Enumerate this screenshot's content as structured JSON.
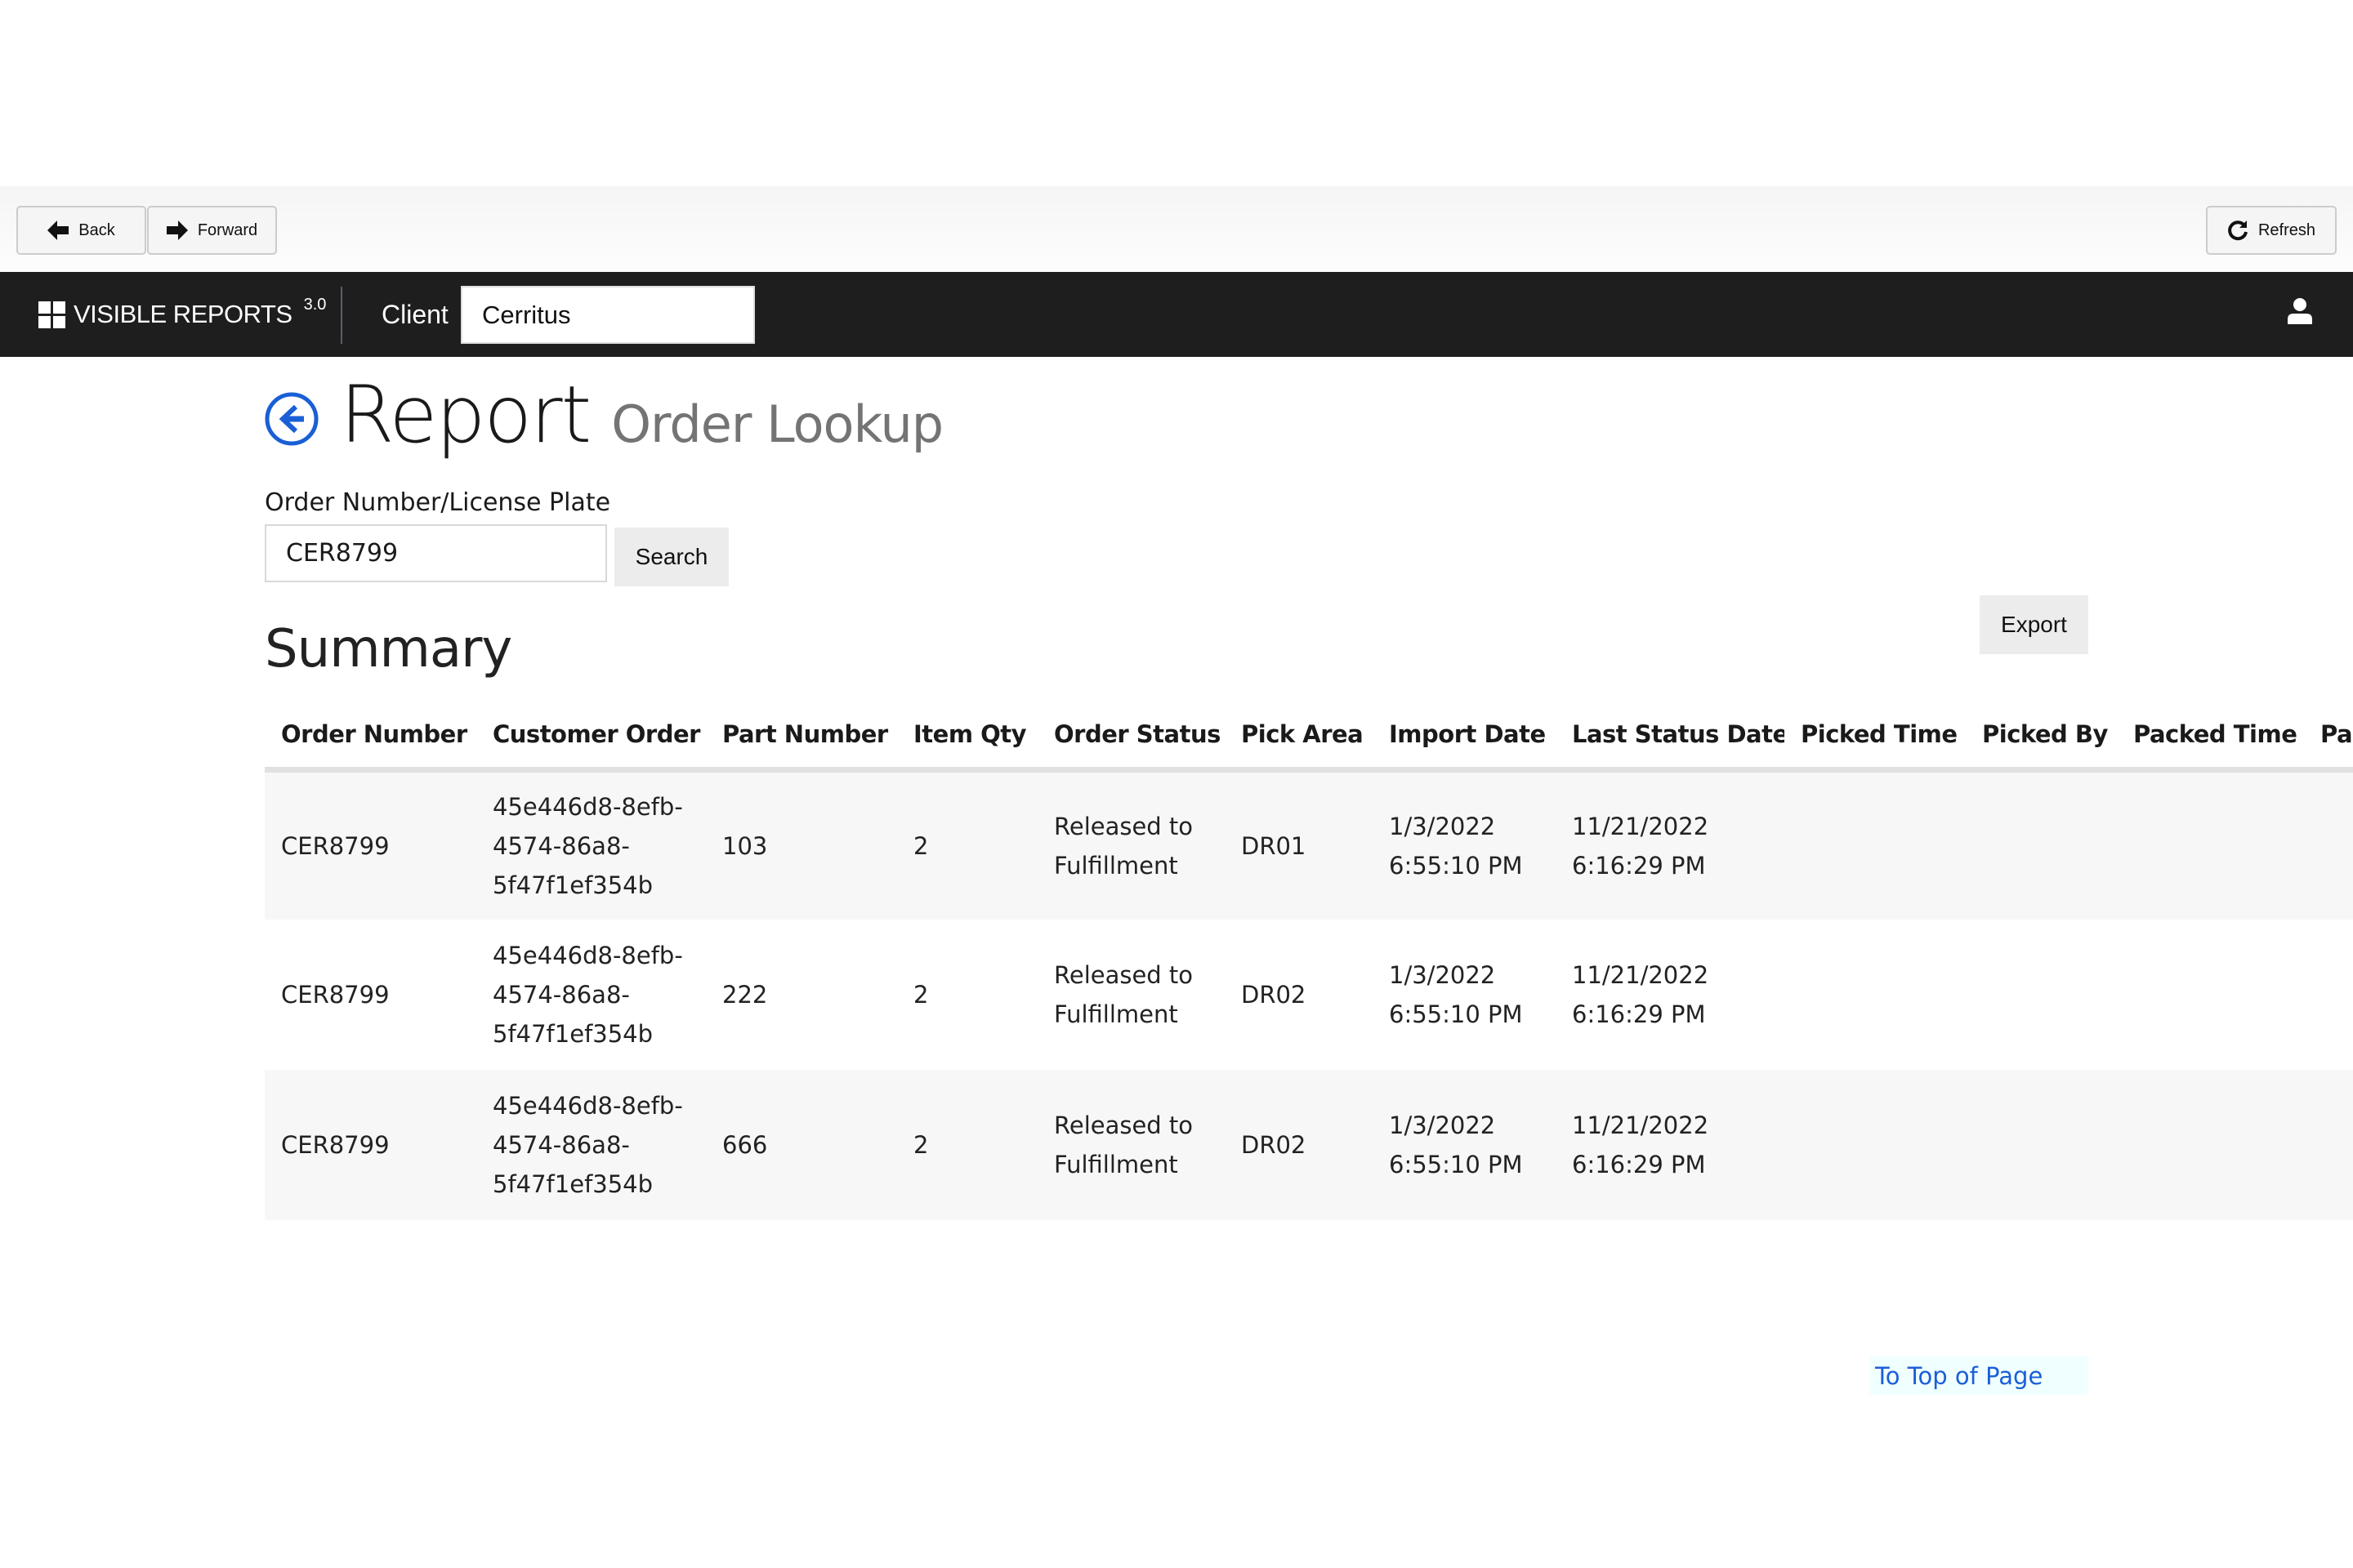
{
  "toolbar": {
    "back_label": "Back",
    "forward_label": "Forward",
    "refresh_label": "Refresh"
  },
  "navbar": {
    "brand_name": "VISIBLE REPORTS",
    "brand_version": "3.0",
    "client_label": "Client",
    "client_value": "Cerritus",
    "user_icon": "user-icon"
  },
  "page": {
    "title": "Report",
    "subtitle": "Order Lookup",
    "back_icon": "arrow-left-circle-icon"
  },
  "search": {
    "label": "Order Number/License Plate",
    "value": "CER8799",
    "button_label": "Search"
  },
  "summary": {
    "title": "Summary",
    "export_label": "Export",
    "columns": [
      "Order Number",
      "Customer Order",
      "Part Number",
      "Item Qty",
      "Order Status",
      "Pick Area",
      "Import Date",
      "Last Status Date",
      "Picked Time",
      "Picked By",
      "Packed Time",
      "Packed By"
    ],
    "rows": [
      {
        "order_number": "CER8799",
        "customer_order": [
          "45e446d8-8efb-",
          "4574-86a8-",
          "5f47f1ef354b"
        ],
        "part_number": "103",
        "item_qty": "2",
        "order_status": [
          "Released to",
          "Fulfillment"
        ],
        "pick_area": "DR01",
        "import_date": [
          "1/3/2022",
          "6:55:10 PM"
        ],
        "last_status_date": [
          "11/21/2022",
          "6:16:29 PM"
        ],
        "picked_time": "",
        "picked_by": "",
        "packed_time": "",
        "packed_by": ""
      },
      {
        "order_number": "CER8799",
        "customer_order": [
          "45e446d8-8efb-",
          "4574-86a8-",
          "5f47f1ef354b"
        ],
        "part_number": "222",
        "item_qty": "2",
        "order_status": [
          "Released to",
          "Fulfillment"
        ],
        "pick_area": "DR02",
        "import_date": [
          "1/3/2022",
          "6:55:10 PM"
        ],
        "last_status_date": [
          "11/21/2022",
          "6:16:29 PM"
        ],
        "picked_time": "",
        "picked_by": "",
        "packed_time": "",
        "packed_by": ""
      },
      {
        "order_number": "CER8799",
        "customer_order": [
          "45e446d8-8efb-",
          "4574-86a8-",
          "5f47f1ef354b"
        ],
        "part_number": "666",
        "item_qty": "2",
        "order_status": [
          "Released to",
          "Fulfillment"
        ],
        "pick_area": "DR02",
        "import_date": [
          "1/3/2022",
          "6:55:10 PM"
        ],
        "last_status_date": [
          "11/21/2022",
          "6:16:29 PM"
        ],
        "picked_time": "",
        "picked_by": "",
        "packed_time": "",
        "packed_by": ""
      }
    ]
  },
  "footer": {
    "to_top_label": "To Top of Page"
  },
  "colors": {
    "navbar_bg": "#1e1e1e",
    "accent_link": "#1a5fd6",
    "row_stripe": "#f7f7f7",
    "button_bg": "#ececec"
  }
}
